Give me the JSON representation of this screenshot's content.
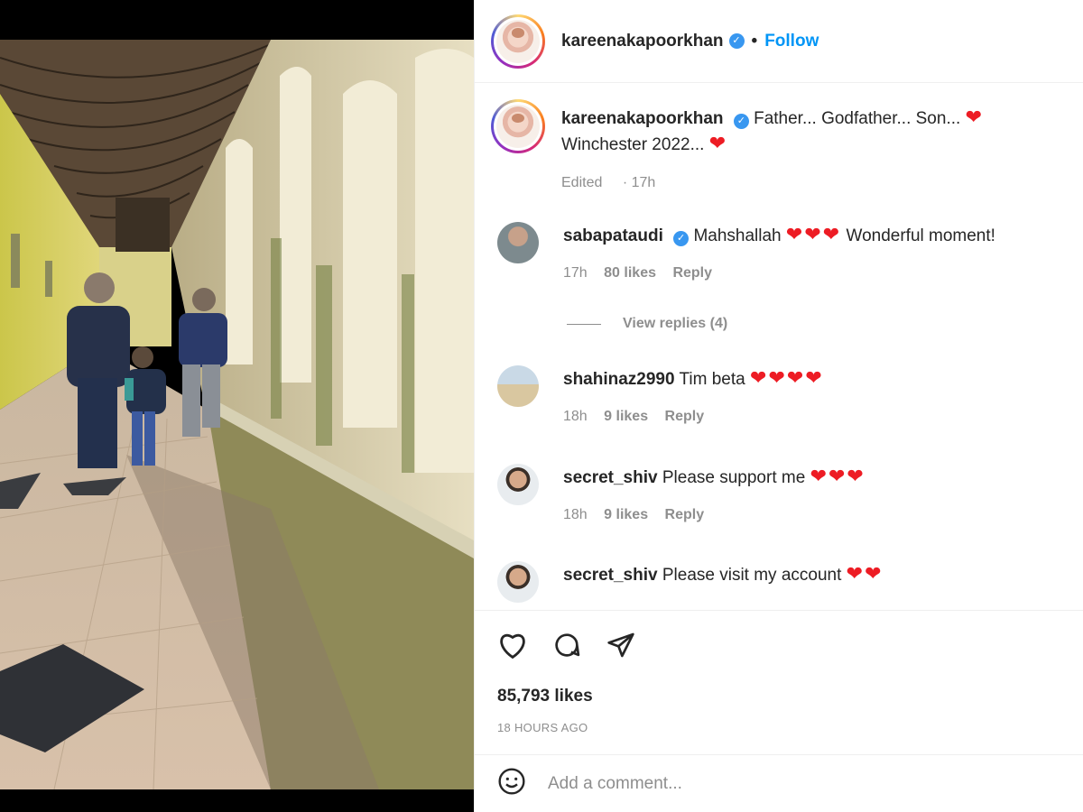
{
  "header": {
    "username": "kareenakapoorkhan",
    "separator": "•",
    "follow_label": "Follow",
    "verified_icon": "check"
  },
  "caption": {
    "username": "kareenakapoorkhan",
    "text_line1": "Father... Godfather... Son...",
    "text_line2": "Winchester 2022...",
    "hearts1": "❤",
    "hearts2": "❤",
    "edited": "Edited",
    "time": "17h"
  },
  "comments": [
    {
      "username": "sabapataudi",
      "verified": true,
      "text": "Mahshallah",
      "hearts": "❤❤❤",
      "after": "Wonderful moment!",
      "time": "17h",
      "likes": "80 likes",
      "reply": "Reply"
    },
    {
      "username": "shahinaz2990",
      "verified": false,
      "text": "Tim beta",
      "hearts": "❤❤❤❤",
      "after": "",
      "time": "18h",
      "likes": "9 likes",
      "reply": "Reply"
    },
    {
      "username": "secret_shiv",
      "verified": false,
      "text": "Please support me",
      "hearts": "❤❤❤",
      "after": "",
      "time": "18h",
      "likes": "9 likes",
      "reply": "Reply"
    },
    {
      "username": "secret_shiv",
      "verified": false,
      "text": "Please visit my account",
      "hearts": "❤❤",
      "after": "",
      "time": "",
      "likes": "",
      "reply": ""
    }
  ],
  "view_replies": "View replies (4)",
  "actions": {
    "likes": "85,793 likes",
    "time_ago": "18 HOURS AGO",
    "icons": [
      "heart-icon",
      "comment-icon",
      "share-icon"
    ]
  },
  "add_comment": {
    "placeholder": "Add a comment...",
    "emoji_icon": "smiley-icon"
  },
  "colors": {
    "accent": "#0095f6",
    "heart": "#ed1c24",
    "muted": "#8e8e8e",
    "verified": "#3897f0"
  }
}
